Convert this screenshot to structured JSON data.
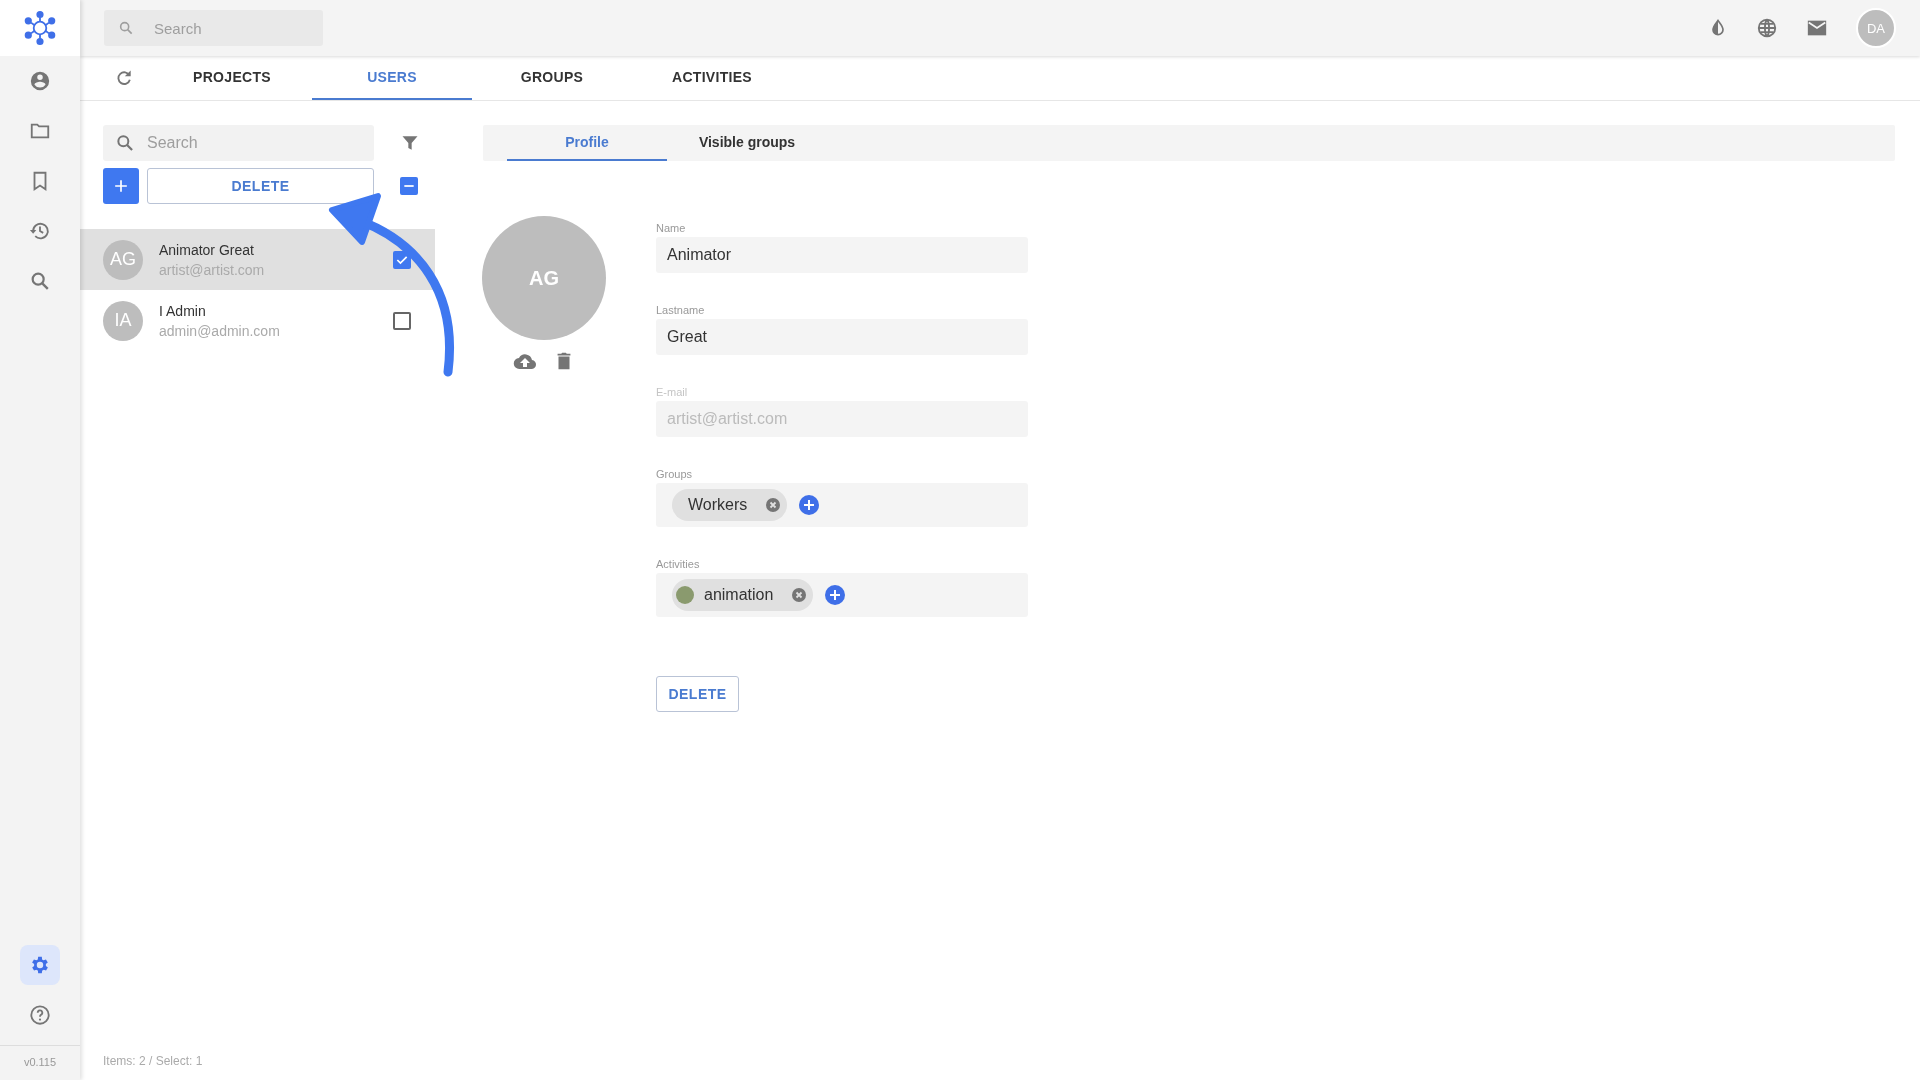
{
  "sidebar": {
    "items": [
      {
        "selected": false
      },
      {
        "selected": false
      },
      {
        "selected": false
      },
      {
        "selected": false
      },
      {
        "selected": false
      }
    ],
    "bottom_items": [
      {
        "selected": true
      },
      {
        "selected": false
      }
    ],
    "version": "v0.115"
  },
  "topbar": {
    "search": {
      "placeholder": "Search"
    },
    "user_initials": "DA"
  },
  "tabs": [
    {
      "label": "PROJECTS",
      "selected": false
    },
    {
      "label": "USERS",
      "selected": true
    },
    {
      "label": "GROUPS",
      "selected": false
    },
    {
      "label": "ACTIVITIES",
      "selected": false
    }
  ],
  "user_list": {
    "search": {
      "placeholder": "Search"
    },
    "delete_button": "DELETE",
    "select_all": {
      "indeterminate": true
    },
    "users": [
      {
        "initials": "AG",
        "name": "Animator Great",
        "email": "artist@artist.com",
        "selected": true,
        "checked": true
      },
      {
        "initials": "IA",
        "name": "I Admin",
        "email": "admin@admin.com",
        "selected": false,
        "checked": false
      }
    ],
    "status": "Items: 2 / Select: 1"
  },
  "detail": {
    "tabs": [
      {
        "label": "Profile",
        "selected": true
      },
      {
        "label": "Visible groups",
        "selected": false
      }
    ],
    "avatar_initials": "AG",
    "fields": [
      {
        "label": "Name",
        "value": "Animator",
        "disabled": false
      },
      {
        "label": "Lastname",
        "value": "Great",
        "disabled": false
      },
      {
        "label": "E-mail",
        "value": "artist@artist.com",
        "disabled": true
      }
    ],
    "chip_fields": [
      {
        "label": "Groups",
        "chips": [
          {
            "text": "Workers"
          }
        ]
      },
      {
        "label": "Activities",
        "chips": [
          {
            "text": "animation",
            "color": "#8a9a6e"
          }
        ]
      }
    ],
    "delete_button": "DELETE"
  }
}
